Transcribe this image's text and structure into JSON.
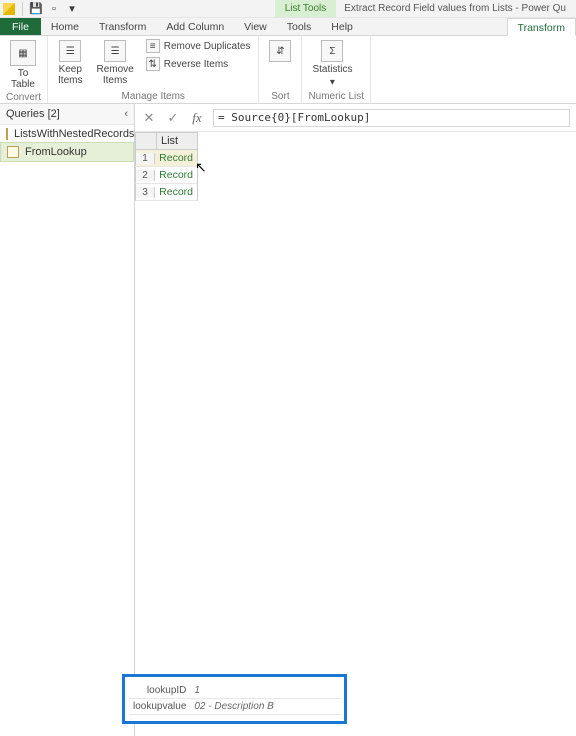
{
  "qat": {
    "list_tools": "List Tools",
    "doc_title": "Extract Record Field values from Lists - Power Qu"
  },
  "tabs": {
    "file": "File",
    "home": "Home",
    "transform": "Transform",
    "add_column": "Add Column",
    "view": "View",
    "tools": "Tools",
    "help": "Help",
    "transform2": "Transform"
  },
  "ribbon": {
    "to_table": "To\nTable",
    "keep_items": "Keep\nItems",
    "remove_items": "Remove\nItems",
    "remove_dup": "Remove Duplicates",
    "reverse": "Reverse Items",
    "sort": "",
    "statistics": "Statistics",
    "groups": {
      "convert": "Convert",
      "manage": "Manage Items",
      "sort": "Sort",
      "numeric": "Numeric List"
    }
  },
  "queries": {
    "title": "Queries [2]",
    "items": [
      {
        "label": "ListsWithNestedRecords"
      },
      {
        "label": "FromLookup"
      }
    ]
  },
  "formula": "= Source{0}[FromLookup]",
  "grid": {
    "header": "List",
    "rows": [
      {
        "idx": "1",
        "val": "Record"
      },
      {
        "idx": "2",
        "val": "Record"
      },
      {
        "idx": "3",
        "val": "Record"
      }
    ]
  },
  "preview": {
    "rows": [
      {
        "key": "lookupID",
        "val": "1"
      },
      {
        "key": "lookupvalue",
        "val": "02 - Description B"
      }
    ]
  }
}
